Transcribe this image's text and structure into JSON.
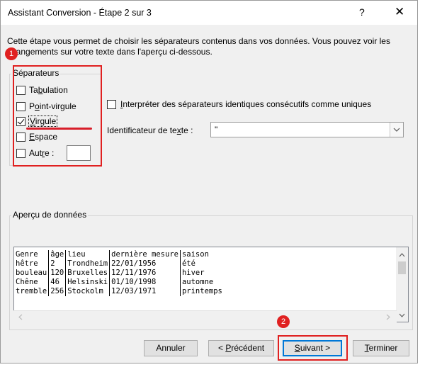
{
  "window": {
    "title": "Assistant Conversion - Étape 2 sur 3",
    "help_glyph": "?",
    "close_glyph": "✕"
  },
  "description": "Cette étape vous permet de choisir les séparateurs contenus dans vos données. Vous pouvez voir les changements sur votre texte dans l'aperçu ci-dessous.",
  "separators": {
    "group_label": "Séparateurs",
    "tab": {
      "pre": "Ta",
      "key": "b",
      "post": "ulation",
      "checked": false
    },
    "semicolon": {
      "pre": "P",
      "key": "o",
      "post": "int-virgule",
      "checked": false
    },
    "comma": {
      "pre": "",
      "key": "V",
      "post": "irgule",
      "checked": true
    },
    "space": {
      "pre": "",
      "key": "E",
      "post": "space",
      "checked": false
    },
    "other": {
      "pre": "Aut",
      "key": "r",
      "post": "e :",
      "checked": false,
      "value": ""
    }
  },
  "consecutive": {
    "pre": "",
    "key": "I",
    "post": "nterpréter des séparateurs identiques consécutifs comme uniques",
    "checked": false
  },
  "text_qualifier": {
    "pre": "Identificateur de te",
    "key": "x",
    "post": "te :",
    "value": "\""
  },
  "preview": {
    "label": "Aperçu de données",
    "rows": [
      [
        "Genre",
        "âge",
        "lieu",
        "dernière mesure",
        "saison"
      ],
      [
        "hêtre",
        "2",
        "Trondheim",
        "22/01/1956",
        "été"
      ],
      [
        "bouleau",
        "120",
        "Bruxelles",
        "12/11/1976",
        "hiver"
      ],
      [
        "Chêne",
        "46",
        "Helsinski",
        "01/10/1998",
        "automne"
      ],
      [
        "tremble",
        "256",
        "Stockolm",
        "12/03/1971",
        "printemps"
      ]
    ]
  },
  "buttons": {
    "cancel": "Annuler",
    "back": {
      "pre": "< ",
      "key": "P",
      "post": "récédent"
    },
    "next": {
      "pre": "",
      "key": "S",
      "post": "uivant >"
    },
    "finish": {
      "pre": "",
      "key": "T",
      "post": "erminer"
    }
  },
  "annotations": {
    "badge1": "1",
    "badge2": "2"
  },
  "colors": {
    "annotation_red": "#e02020",
    "dialog_bg": "#f0f0f0",
    "focus_blue": "#0078d7"
  }
}
